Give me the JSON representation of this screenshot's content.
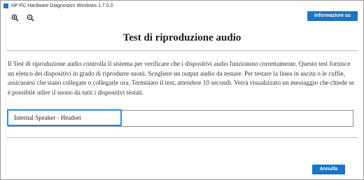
{
  "window": {
    "title": "HP PC Hardware Diagnostics Windows 1.7.0.0"
  },
  "toolbar": {
    "zoom_in_icon": "zoom-in-icon",
    "zoom_out_icon": "zoom-out-icon",
    "info_label": "Informazioni su"
  },
  "main": {
    "heading": "Test di riproduzione audio",
    "description": "Il Test di riproduzione audio controlla il sistema per verificare che i dispositivi audio funzionino correttamente. Questo test fornisce un elenco dei dispositivi in grado di riprodurre suoni. Scegliere un output audio da testare. Per testare la linea in uscita o le cuffie, assicurarsi che siano collegate o collegarle ora. Terminato il test, attendere 10 secondi. Verrà visualizzato un messaggio che chiede se è possibile udire il suono da tutti i dispositivi testati.",
    "devices": [
      {
        "label": "Internal Speaker - Headset",
        "selected": true
      }
    ]
  },
  "footer": {
    "cancel_label": "Annulla"
  },
  "colors": {
    "accent": "#1a74c8",
    "selection_border": "#2f8fdc"
  }
}
